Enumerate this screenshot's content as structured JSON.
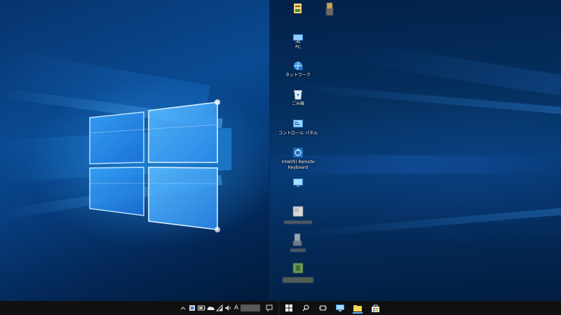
{
  "desktop_icons": [
    {
      "id": "file",
      "label": ""
    },
    {
      "id": "user",
      "label": ""
    },
    {
      "id": "pc",
      "label": "PC"
    },
    {
      "id": "network",
      "label": "ネットワーク"
    },
    {
      "id": "recycle",
      "label": "ごみ箱"
    },
    {
      "id": "control-panel",
      "label": "コントロール パネル"
    },
    {
      "id": "remote-keyboard",
      "label": "Intel(R) Remote Keyboard"
    },
    {
      "id": "monitor",
      "label": ""
    },
    {
      "id": "blur1",
      "label": ""
    },
    {
      "id": "blur2",
      "label": ""
    },
    {
      "id": "blur3",
      "label": ""
    }
  ],
  "taskbar": {
    "tray_ime": "A",
    "tray_icons": [
      "chevron-up-icon",
      "defender-icon",
      "battery-icon",
      "onedrive-icon",
      "network-icon",
      "volume-icon"
    ],
    "colors": {
      "bg": "#101010",
      "accent": "#6fb4ff"
    },
    "pinned": [
      "windows-start-icon",
      "search-icon",
      "task-view-icon",
      "remote-desktop-icon",
      "file-explorer-icon",
      "store-icon"
    ]
  },
  "accent_color": "#1e90ff"
}
